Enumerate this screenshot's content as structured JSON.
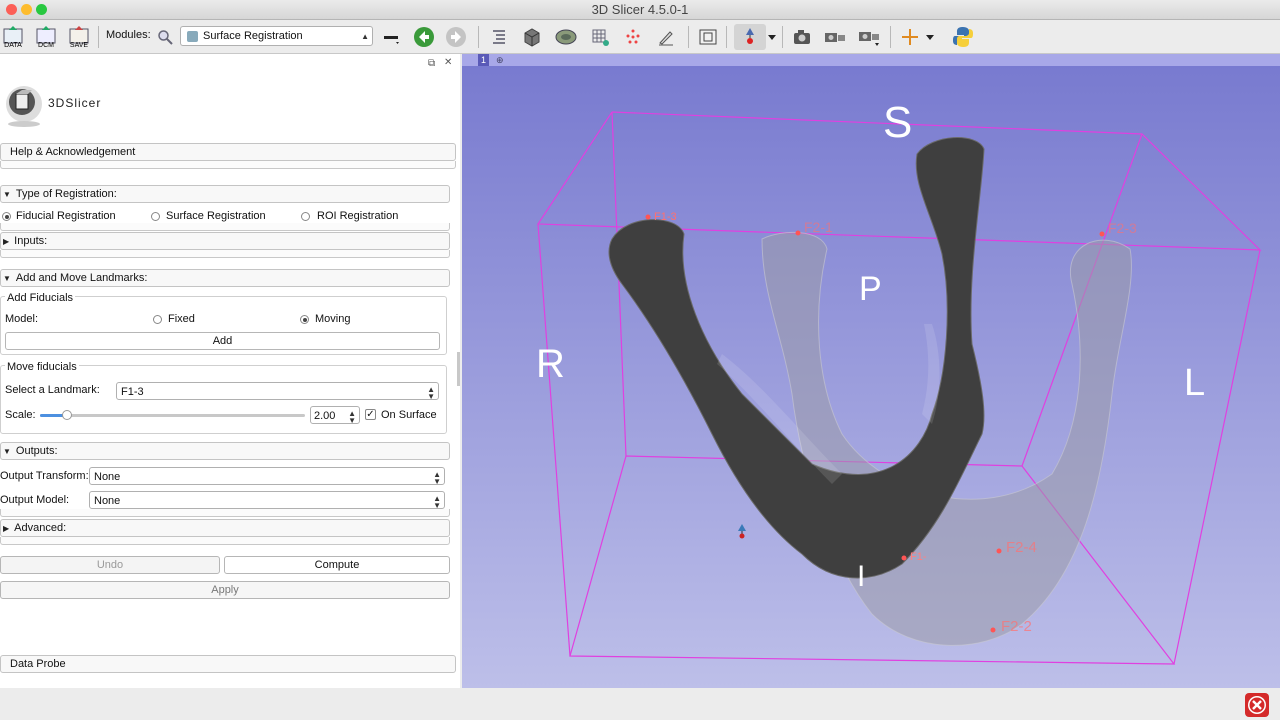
{
  "window": {
    "title": "3D Slicer 4.5.0-1"
  },
  "toolbar": {
    "data_label": "DATA",
    "dcm_label": "DCM",
    "save_label": "SAVE",
    "modules_label": "Modules:",
    "module_selected": "Surface Registration"
  },
  "panel": {
    "logo_text": "3DSlicer",
    "help_section": "Help & Acknowledgement",
    "type_section": "Type of Registration:",
    "registration_options": [
      "Fiducial Registration",
      "Surface Registration",
      "ROI Registration"
    ],
    "inputs_section": "Inputs:",
    "landmarks_section": "Add and Move Landmarks:",
    "add_fiducials_title": "Add Fiducials",
    "model_label": "Model:",
    "model_options": [
      "Fixed",
      "Moving"
    ],
    "add_button": "Add",
    "move_fiducials_title": "Move fiducials",
    "select_landmark_label": "Select a Landmark:",
    "select_landmark_value": "F1-3",
    "scale_label": "Scale:",
    "scale_value": "2.00",
    "on_surface_label": "On Surface",
    "outputs_section": "Outputs:",
    "output_transform_label": "Output Transform:",
    "output_transform_value": "None",
    "output_model_label": "Output Model:",
    "output_model_value": "None",
    "advanced_section": "Advanced:",
    "undo_button": "Undo",
    "compute_button": "Compute",
    "apply_button": "Apply",
    "data_probe_section": "Data Probe"
  },
  "viewer": {
    "view_number": "1",
    "orientation": {
      "superior": "S",
      "posterior": "P",
      "right": "R",
      "left": "L",
      "inferior": "I"
    },
    "fiducials": [
      "F1-3",
      "F2-1",
      "F2-3",
      "F1-",
      "F2-4",
      "F2-2"
    ],
    "colors": {
      "background_top": "#7779cf",
      "background_bottom": "#bdbfe9",
      "bounding_box": "#e040e0",
      "fiducial": "#ff6666"
    }
  }
}
